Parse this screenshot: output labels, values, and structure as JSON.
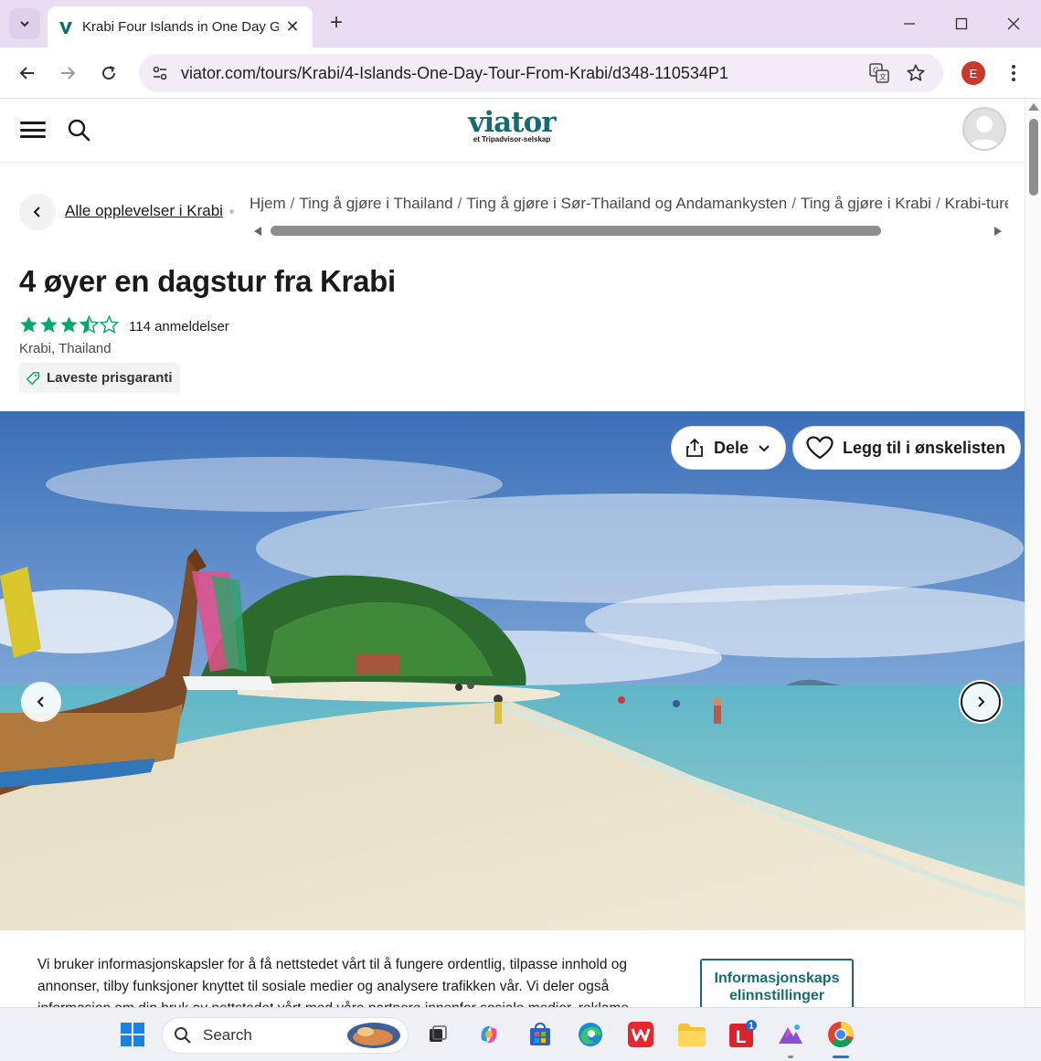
{
  "browser": {
    "tab_title": "Krabi Four Islands in One Day G",
    "url": "viator.com/tours/Krabi/4-Islands-One-Day-Tour-From-Krabi/d348-110534P1",
    "profile_initial": "E"
  },
  "header": {
    "logo_text": "viator",
    "logo_subtitle": "et Tripadvisor-selskap"
  },
  "nav": {
    "back_link": "Alle opplevelser i Krabi",
    "breadcrumbs": [
      "Hjem",
      "Ting å gjøre i Thailand",
      "Ting å gjøre i Sør-Thailand og Andamankysten",
      "Ting å gjøre i Krabi",
      "Krabi-turer"
    ],
    "crumb_separator": "/"
  },
  "product": {
    "title": "4 øyer en dagstur fra Krabi",
    "rating": 3.5,
    "rating_max": 5,
    "review_count": "114 anmeldelser",
    "location": "Krabi, Thailand",
    "badge": "Laveste prisgaranti"
  },
  "hero": {
    "share_label": "Dele",
    "wishlist_label": "Legg til i ønskelisten"
  },
  "cookie": {
    "text": "Vi bruker informasjonskapsler for å få nettstedet vårt til å fungere ordentlig, tilpasse innhold og annonser, tilby funksjoner knyttet til sosiale medier og analysere trafikken vår. Vi deler også informasjon om din bruk av nettstedet vårt med våre partnere innenfor sosiale medier, reklame",
    "button": "Informasjonskaps elinnstillinger"
  },
  "taskbar": {
    "search_placeholder": "Search",
    "badge_count": "1"
  },
  "colors": {
    "brand": "#186b6d",
    "star": "#04a66b",
    "tabstrip": "#e9ddf3"
  }
}
